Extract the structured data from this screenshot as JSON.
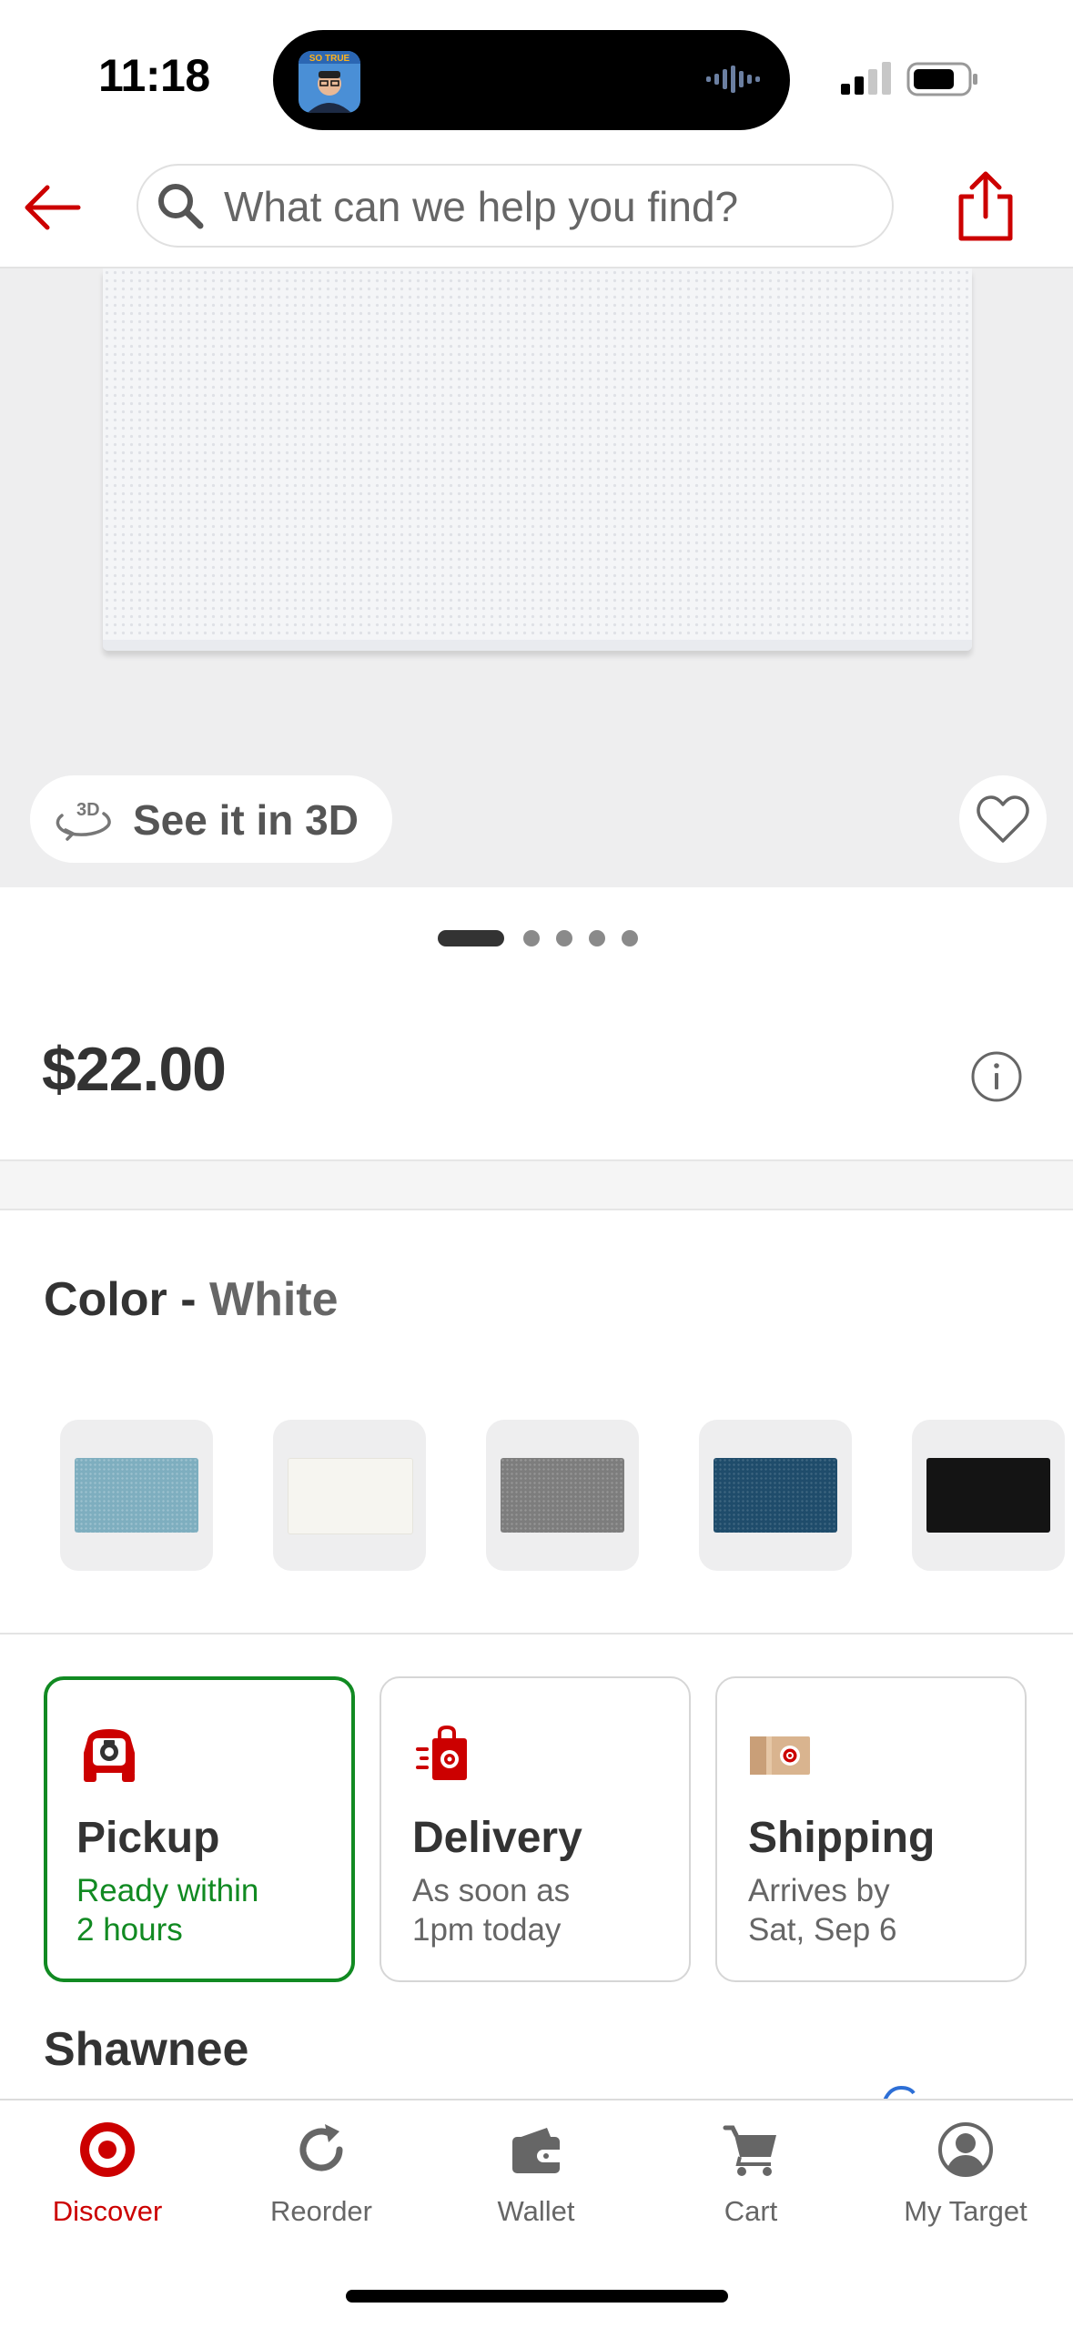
{
  "status_bar": {
    "time": "11:18",
    "island_app_label": "SO TRUE"
  },
  "header": {
    "search_placeholder": "What can we help you find?"
  },
  "hero": {
    "view_3d_label": "See it in 3D",
    "page_count": 5,
    "active_page": 1
  },
  "product": {
    "price": "$22.00"
  },
  "color": {
    "label": "Color",
    "separator": " - ",
    "selected": "White",
    "swatches": [
      {
        "name": "light-blue",
        "color": "#7eaebf"
      },
      {
        "name": "white",
        "color": "#f6f5f0"
      },
      {
        "name": "gray",
        "color": "#7d7d7d"
      },
      {
        "name": "navy",
        "color": "#1f4c6b"
      },
      {
        "name": "black",
        "color": "#141414"
      }
    ]
  },
  "fulfillment": [
    {
      "title": "Pickup",
      "line1": "Ready within",
      "line2": "2 hours",
      "selected": true
    },
    {
      "title": "Delivery",
      "line1": "As soon as",
      "line2": "1pm today",
      "selected": false
    },
    {
      "title": "Shipping",
      "line1": "Arrives by",
      "line2": "Sat, Sep 6",
      "selected": false
    }
  ],
  "store": {
    "name": "Shawnee"
  },
  "tabbar": {
    "items": [
      {
        "label": "Discover",
        "icon": "target-bullseye-icon",
        "active": true
      },
      {
        "label": "Reorder",
        "icon": "reorder-refresh-icon",
        "active": false
      },
      {
        "label": "Wallet",
        "icon": "wallet-icon",
        "active": false
      },
      {
        "label": "Cart",
        "icon": "cart-icon",
        "active": false
      },
      {
        "label": "My Target",
        "icon": "account-icon",
        "active": false
      }
    ]
  },
  "colors": {
    "brand_red": "#cc0000",
    "pickup_green": "#118a22",
    "text_dark": "#333333",
    "text_muted": "#666666"
  }
}
